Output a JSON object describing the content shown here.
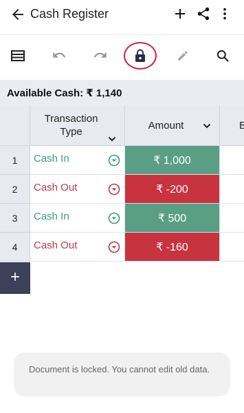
{
  "appbar": {
    "title": "Cash Register",
    "icons": [
      "arrow-back-icon",
      "add-icon",
      "share-icon",
      "more-vertical-icon"
    ]
  },
  "toolbar": {
    "icons": [
      "table-view-icon",
      "undo-icon",
      "redo-icon",
      "lock-icon",
      "pencil-icon",
      "search-icon"
    ],
    "highlight_color": "#d0243a"
  },
  "summary": {
    "available_cash": "Available Cash: ₹ 1,140"
  },
  "table": {
    "headers": [
      {
        "label": "Transaction\nType"
      },
      {
        "label": "Amount"
      },
      {
        "label": "B"
      }
    ],
    "rows": [
      {
        "num": "1",
        "type": "Cash In",
        "amount": "₹ 1,000",
        "kind": "in"
      },
      {
        "num": "2",
        "type": "Cash Out",
        "amount": "₹ -200",
        "kind": "out"
      },
      {
        "num": "3",
        "type": "Cash In",
        "amount": "₹ 500",
        "kind": "in"
      },
      {
        "num": "4",
        "type": "Cash Out",
        "amount": "₹ -160",
        "kind": "out"
      }
    ]
  },
  "colors": {
    "cash_in_text": "#3d9b7d",
    "cash_out_text": "#c23843",
    "cash_in_fill": "#5a9e86",
    "cash_out_fill": "#c7333f",
    "add_row_bg": "#3b4157"
  },
  "toast": {
    "message": "Document is locked. You cannot edit old data."
  }
}
